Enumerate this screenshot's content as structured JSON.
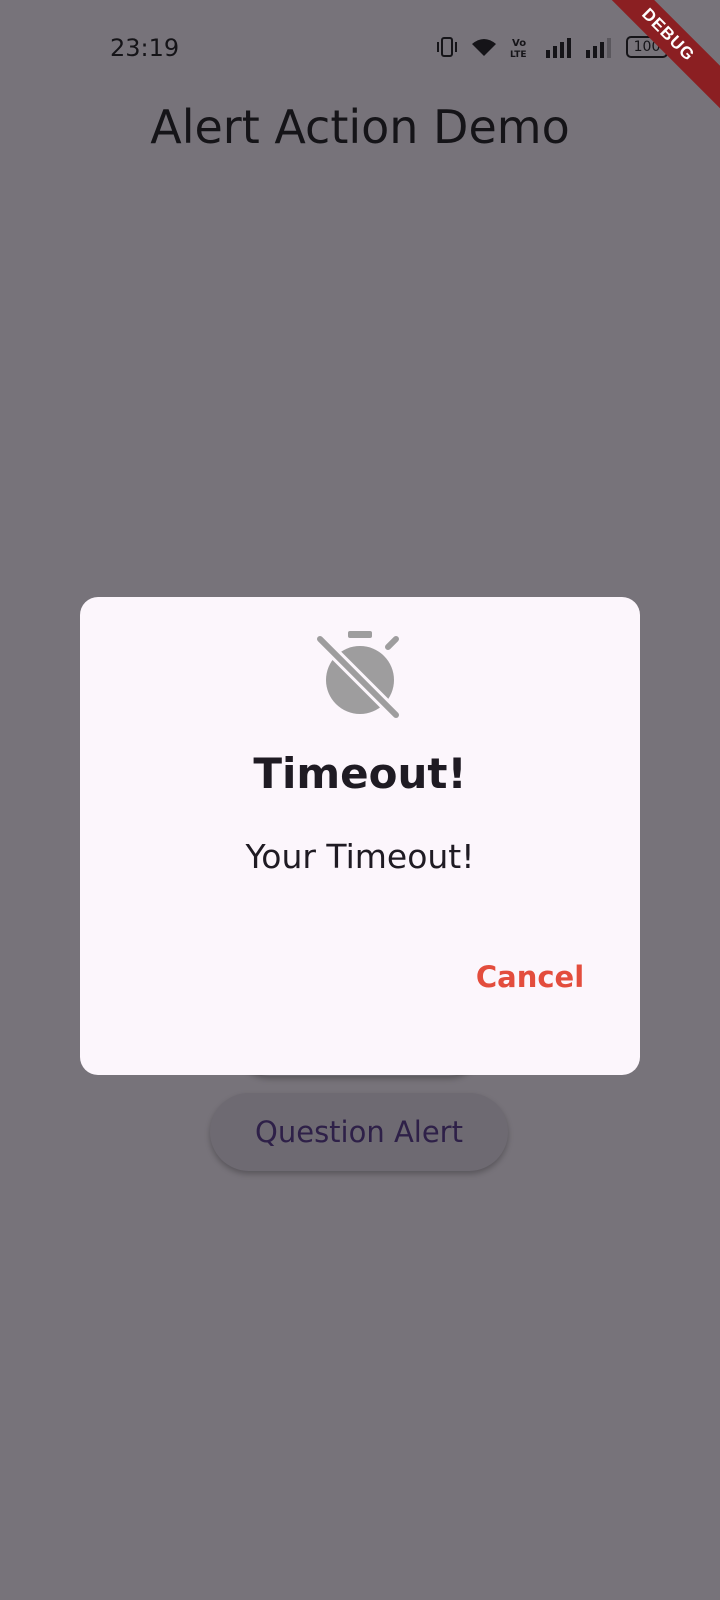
{
  "status_bar": {
    "time": "23:19",
    "battery": "100",
    "icons": [
      "vibrate-icon",
      "wifi-icon",
      "volte-icon",
      "signal-icon",
      "signal-icon",
      "battery-icon"
    ]
  },
  "debug_banner": {
    "label": "DEBUG",
    "color": "#8b1f22"
  },
  "app_bar": {
    "title": "Alert Action Demo"
  },
  "background_buttons": {
    "question_alert_label": "Question Alert"
  },
  "dialog": {
    "icon": "timer-off-icon",
    "title": "Timeout!",
    "message": "Your Timeout!",
    "cancel_label": "Cancel",
    "accent_color": "#e34d3d"
  },
  "colors": {
    "scrim_background": "#77737a",
    "dialog_background": "#fcf6fc",
    "button_text": "#2e2048"
  }
}
